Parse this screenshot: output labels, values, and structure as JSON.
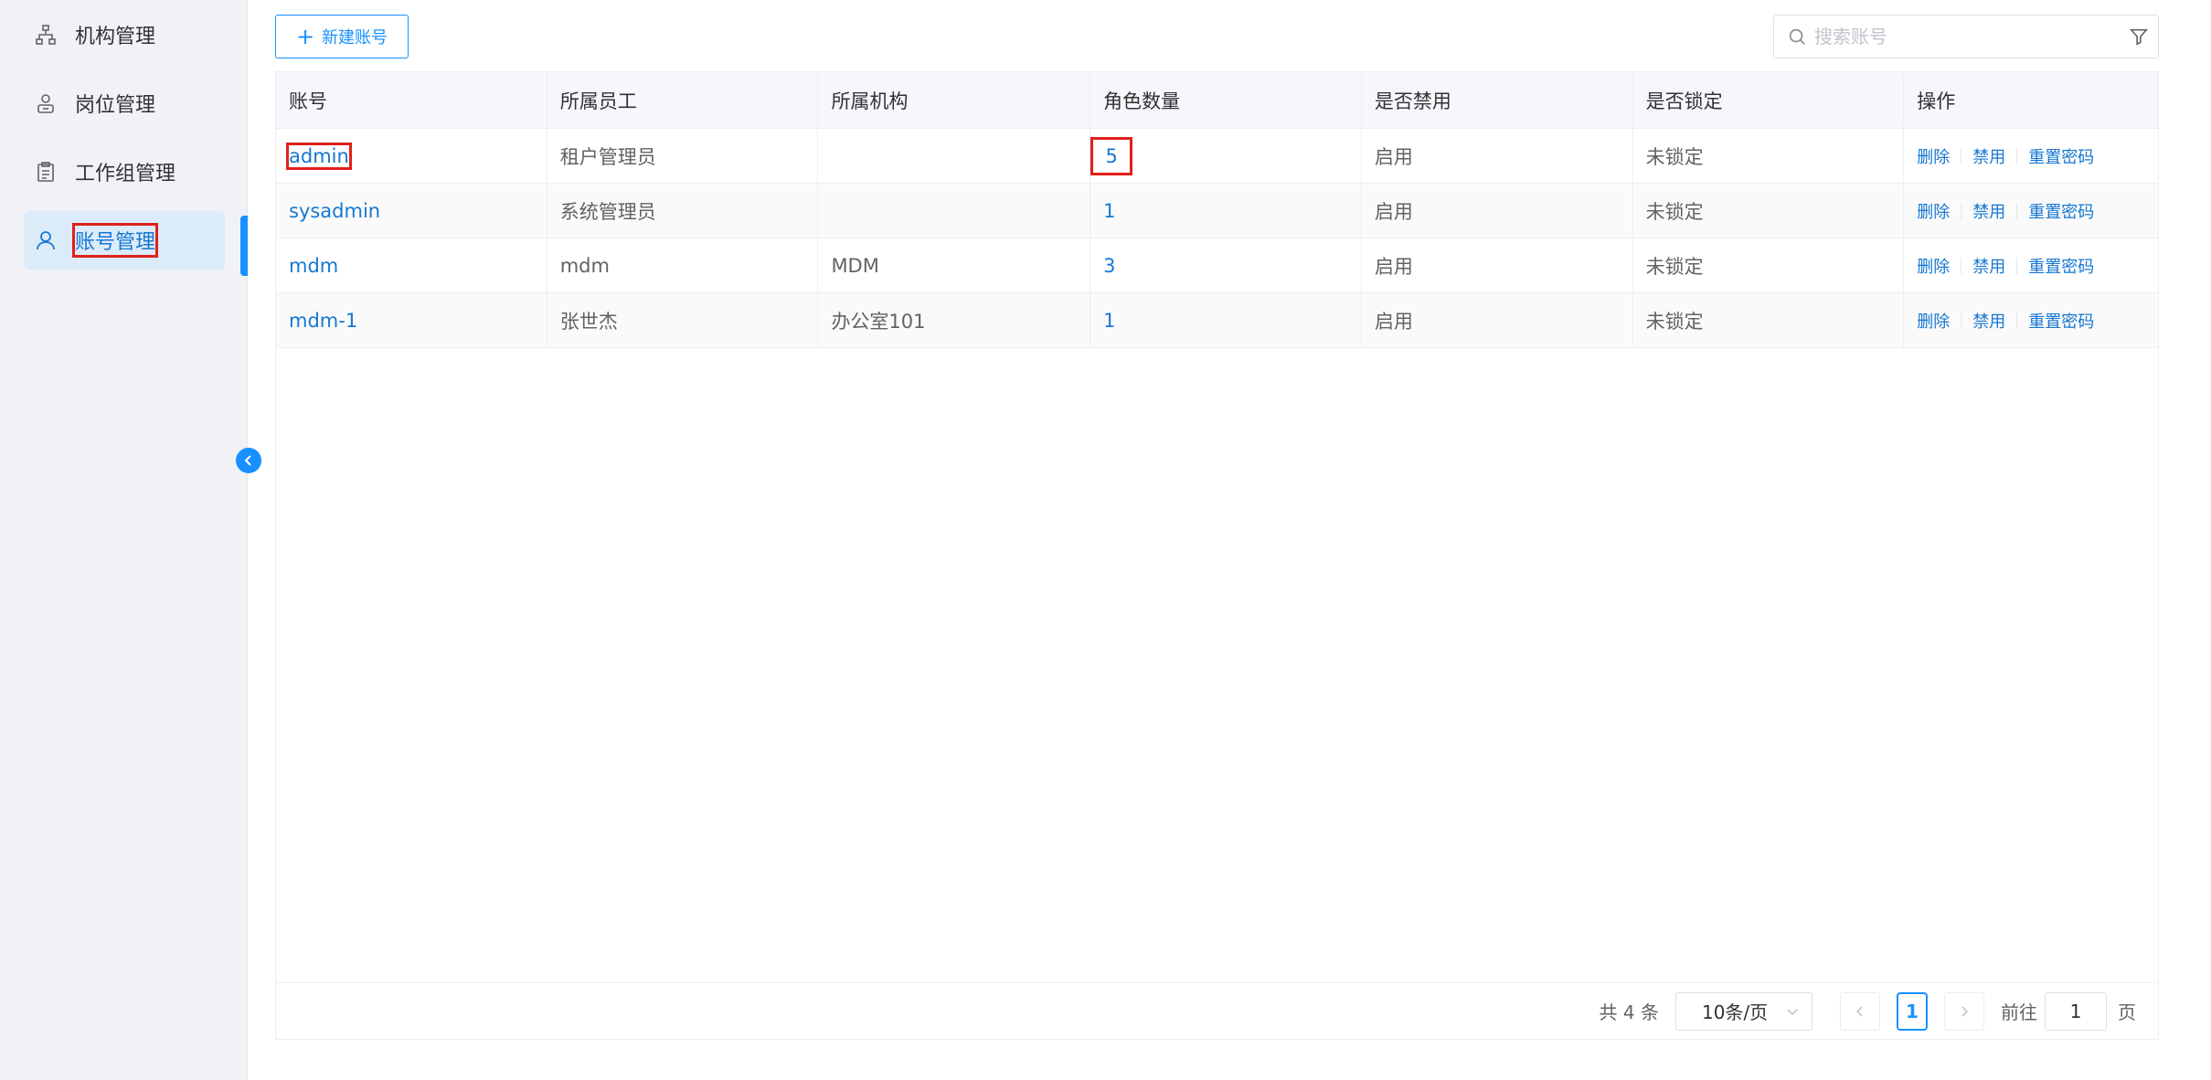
{
  "sidebar": {
    "items": [
      {
        "label": "机构管理",
        "icon": "org-tree-icon",
        "active": false
      },
      {
        "label": "岗位管理",
        "icon": "position-icon",
        "active": false
      },
      {
        "label": "工作组管理",
        "icon": "clipboard-icon",
        "active": false
      },
      {
        "label": "账号管理",
        "icon": "user-icon",
        "active": true
      }
    ]
  },
  "toolbar": {
    "add_label": "新建账号",
    "search_placeholder": "搜索账号"
  },
  "table": {
    "columns": [
      "账号",
      "所属员工",
      "所属机构",
      "角色数量",
      "是否禁用",
      "是否锁定",
      "操作"
    ],
    "rows": [
      {
        "account": "admin",
        "employee": "租户管理员",
        "org": "",
        "roles": "5",
        "disabled": "启用",
        "locked": "未锁定"
      },
      {
        "account": "sysadmin",
        "employee": "系统管理员",
        "org": "",
        "roles": "1",
        "disabled": "启用",
        "locked": "未锁定"
      },
      {
        "account": "mdm",
        "employee": "mdm",
        "org": "MDM",
        "roles": "3",
        "disabled": "启用",
        "locked": "未锁定"
      },
      {
        "account": "mdm-1",
        "employee": "张世杰",
        "org": "办公室101",
        "roles": "1",
        "disabled": "启用",
        "locked": "未锁定"
      }
    ],
    "ops": {
      "delete": "删除",
      "disable": "禁用",
      "reset": "重置密码"
    }
  },
  "pager": {
    "total": "共 4 条",
    "page_size": "10条/页",
    "current": "1",
    "goto_label": "前往",
    "goto_value": "1",
    "page_suffix": "页"
  },
  "colors": {
    "accent": "#1890ff",
    "highlight": "#e0201a"
  }
}
